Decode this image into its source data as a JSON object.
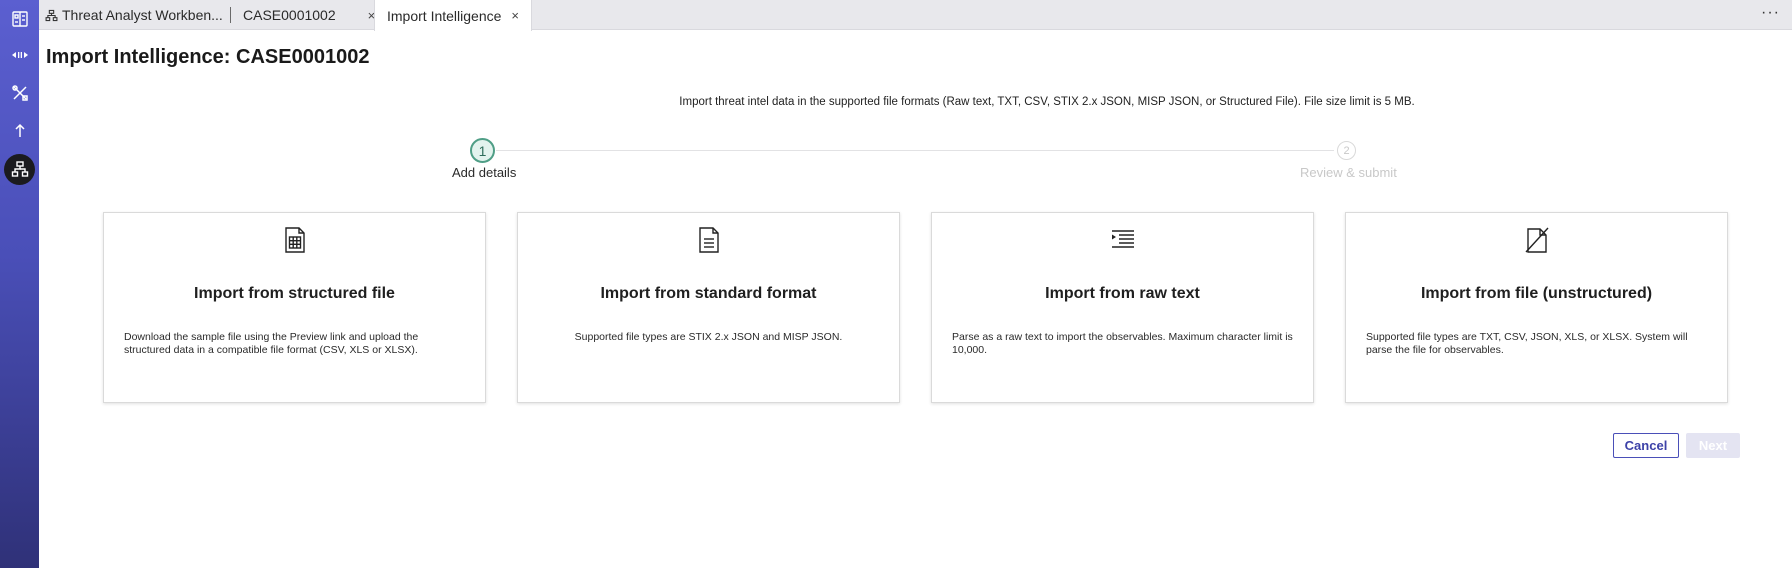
{
  "rail": {
    "items": [
      "workbench-icon",
      "transfer-icon",
      "tools-icon",
      "upload-icon",
      "hierarchy-icon"
    ],
    "active_index": 4,
    "accent": "#4a4fb8"
  },
  "tabs": [
    {
      "label": "Threat Analyst Workben...",
      "icon": "hierarchy-icon",
      "closable": false
    },
    {
      "label": "CASE0001002",
      "closable": true
    },
    {
      "label": "Import Intelligence",
      "closable": true,
      "active": true
    }
  ],
  "tab_close_glyph": "×",
  "more_glyph": "···",
  "page": {
    "title": "Import Intelligence: CASE0001002",
    "intro": "Import threat intel data in the supported file formats (Raw text, TXT, CSV, STIX 2.x JSON, MISP JSON, or Structured File). File size limit is 5 MB."
  },
  "stepper": {
    "steps": [
      {
        "number": "1",
        "label": "Add details",
        "state": "active"
      },
      {
        "number": "2",
        "label": "Review & submit",
        "state": "disabled"
      }
    ]
  },
  "cards": [
    {
      "icon": "spreadsheet-file-icon",
      "title": "Import from structured file",
      "description": "Download the sample file using the Preview link and upload the structured data in a compatible file format (CSV, XLS or XLSX)."
    },
    {
      "icon": "document-file-icon",
      "title": "Import from standard format",
      "description": "Supported file types are STIX 2.x JSON and MISP JSON."
    },
    {
      "icon": "text-indent-icon",
      "title": "Import from raw text",
      "description": "Parse as a raw text to import the observables. Maximum character limit is 10,000."
    },
    {
      "icon": "unstructured-file-icon",
      "title": "Import from file (unstructured)",
      "description": "Supported file types are TXT, CSV, JSON, XLS, or XLSX. System will parse the file for observables."
    }
  ],
  "actions": {
    "cancel_label": "Cancel",
    "next_label": "Next",
    "next_enabled": false
  }
}
